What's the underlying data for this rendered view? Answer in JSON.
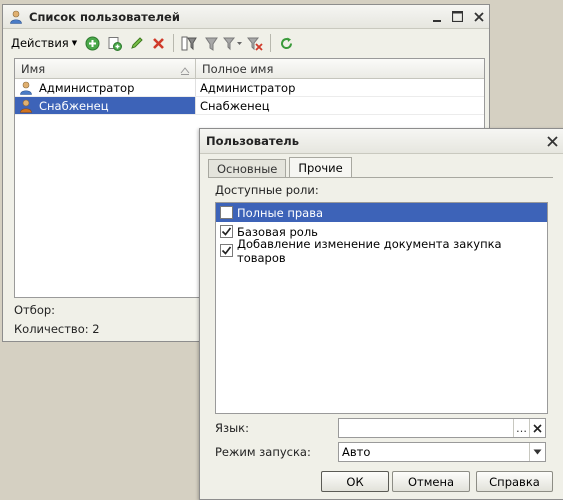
{
  "users_window": {
    "title": "Список пользователей",
    "toolbar": {
      "actions_label": "Действия",
      "icons": [
        "add-icon",
        "copy-icon",
        "edit-icon",
        "delete-icon",
        "filter-icon",
        "filter-by-value-icon",
        "filter-list-icon",
        "clear-filter-icon",
        "refresh-icon"
      ]
    },
    "columns": [
      "Имя",
      "Полное имя"
    ],
    "rows": [
      {
        "name": "Администратор",
        "full_name": "Администратор",
        "selected": false
      },
      {
        "name": "Снабженец",
        "full_name": "Снабженец",
        "selected": true
      }
    ],
    "filter_label": "Отбор:",
    "count_label": "Количество: 2"
  },
  "user_dialog": {
    "title": "Пользователь",
    "tabs": [
      {
        "label": "Основные",
        "active": false
      },
      {
        "label": "Прочие",
        "active": true
      }
    ],
    "roles_label": "Доступные роли:",
    "roles": [
      {
        "label": "Полные права",
        "checked": false,
        "selected": true
      },
      {
        "label": "Базовая роль",
        "checked": true,
        "selected": false
      },
      {
        "label": "Добавление изменение документа закупка товаров",
        "checked": true,
        "selected": false
      }
    ],
    "language": {
      "label": "Язык:",
      "value": ""
    },
    "launch_mode": {
      "label": "Режим запуска:",
      "value": "Авто"
    },
    "buttons": {
      "ok": "ОК",
      "cancel": "Отмена",
      "help": "Справка"
    }
  },
  "colors": {
    "selection": "#3d63b8",
    "desktop": "#d5d0c2",
    "window": "#f0f0e8"
  }
}
